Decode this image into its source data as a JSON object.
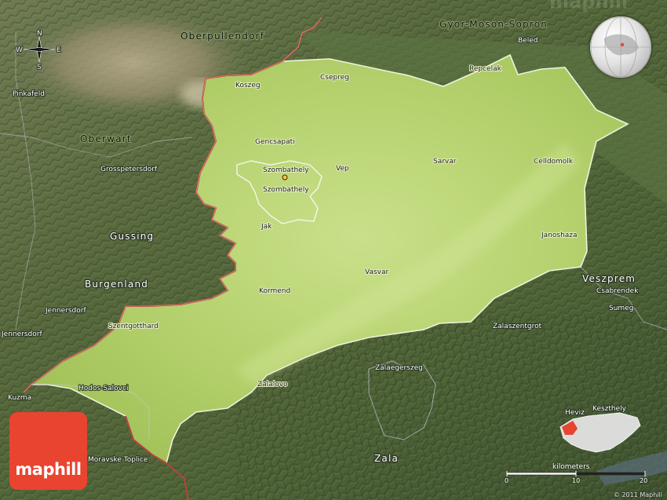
{
  "brand": {
    "name": "maphill",
    "watermark": "maphill",
    "copyright": "© 2011 Maphill"
  },
  "colors": {
    "logo": "#e8442f",
    "border_international": "#b8423c",
    "border_county": "#e8ecd8"
  },
  "compass": {
    "n": "N",
    "s": "S",
    "e": "E",
    "w": "W"
  },
  "scale_bar": {
    "title": "kilometers",
    "ticks": [
      "0",
      "10",
      "20"
    ]
  },
  "regions": {
    "gyor": "Gyor-Moson-Sopron",
    "burgenland": "Burgenland",
    "veszprem": "Veszprem",
    "zala": "Zala",
    "oberwart": "Oberwart",
    "gussing": "Gussing"
  },
  "towns_in_county": {
    "koszeg": "Koszeg",
    "csepreg": "Csepreg",
    "repcelak": "Repcelak",
    "gencsapati": "Gencsapati",
    "szombathely_1": "Szombathely",
    "szombathely_2": "Szombathely",
    "vep": "Vep",
    "sarvar": "Sarvar",
    "celldomolk": "Celldomolk",
    "jak": "Jak",
    "janoshaza": "Janoshaza",
    "vasvar": "Vasvar",
    "kormend": "Kormend",
    "szentgotthard": "Szentgotthard",
    "zalalovo": "Zalalovo"
  },
  "towns_outside": {
    "oberpullendorf": "Oberpullendorf",
    "beled": "Beled",
    "pinkafeld": "Pinkafeld",
    "grosspetersdorf": "Grosspetersdorf",
    "jennersdorf_1": "Jennersdorf",
    "jennersdorf_2": "Jennersdorf",
    "kuzma": "Kuzma",
    "hodos": "Hodos-Salovci",
    "moravske": "Moravske Toplice",
    "csabrendek": "Csabrendek",
    "sumeg": "Sumeg",
    "zalaszentgrot": "Zalaszentgrot",
    "zalaegerszeg": "Zalaegerszeg",
    "heviz": "Heviz",
    "keszthely": "Keszthely"
  }
}
